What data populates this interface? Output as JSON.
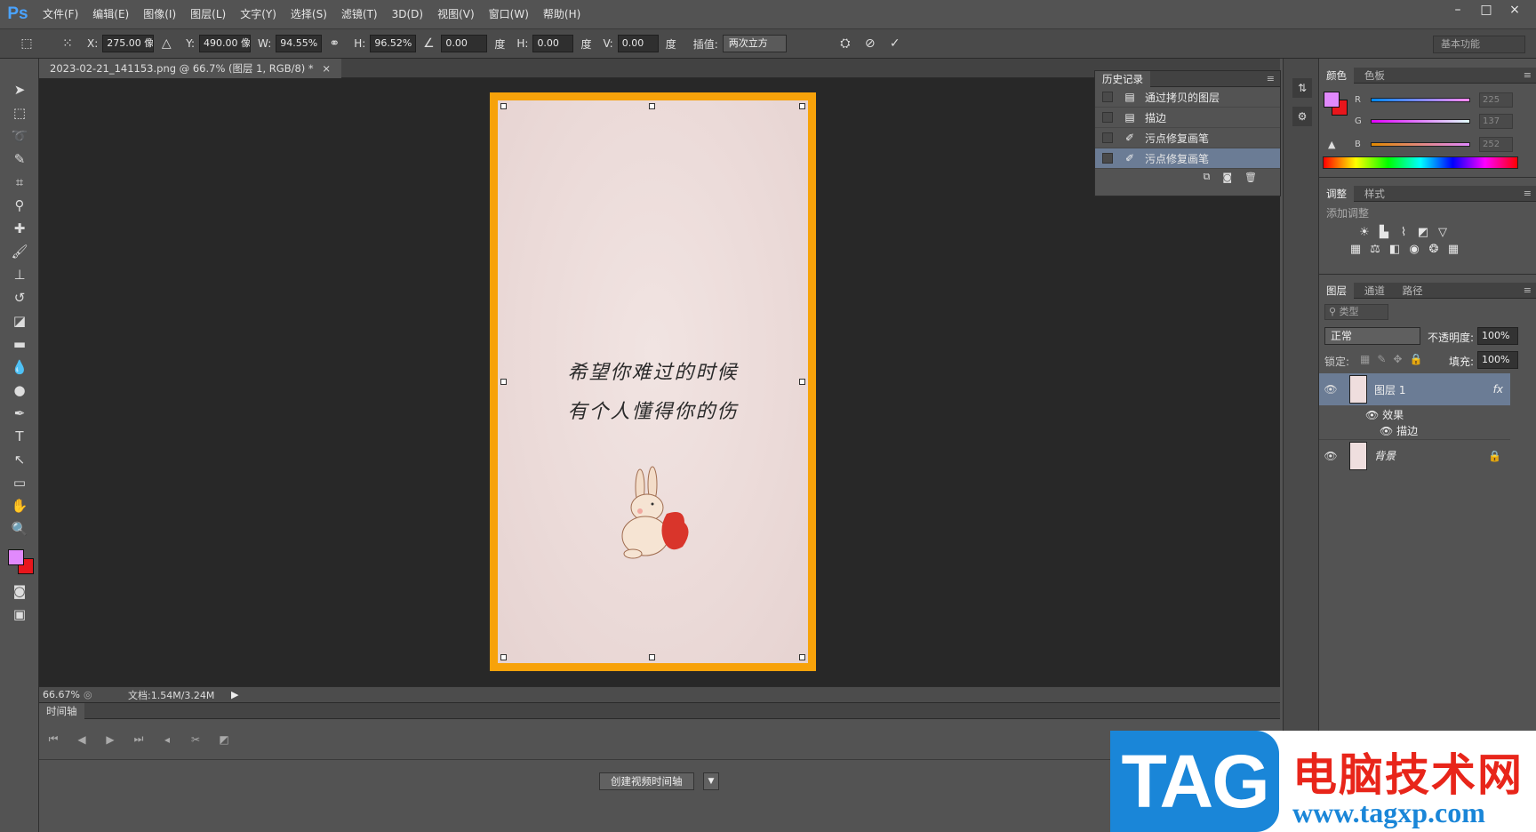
{
  "app": {
    "logo": "Ps"
  },
  "menu": [
    "文件(F)",
    "编辑(E)",
    "图像(I)",
    "图层(L)",
    "文字(Y)",
    "选择(S)",
    "滤镜(T)",
    "3D(D)",
    "视图(V)",
    "窗口(W)",
    "帮助(H)"
  ],
  "window_controls": {
    "minimize": "–",
    "maximize": "□",
    "close": "×"
  },
  "options": {
    "x_label": "X:",
    "x_value": "275.00 像",
    "y_label": "Y:",
    "y_value": "490.00 像",
    "w_label": "W:",
    "w_value": "94.55%",
    "h_label": "H:",
    "h_value": "96.52%",
    "angle_value": "0.00",
    "angle_unit": "度",
    "hskew_label": "H:",
    "hskew_value": "0.00",
    "hskew_unit": "度",
    "vskew_label": "V:",
    "vskew_value": "0.00",
    "vskew_unit": "度",
    "interp_label": "插值:",
    "interp_value": "两次立方",
    "workspace": "基本功能"
  },
  "document": {
    "tab_title": "2023-02-21_141153.png @ 66.7% (图层 1, RGB/8) *",
    "poem_line1": "希望你难过的时候",
    "poem_line2": "有个人懂得你的伤"
  },
  "status": {
    "zoom": "66.67%",
    "doc_size": "文档:1.54M/3.24M"
  },
  "timeline": {
    "tab": "时间轴",
    "create_button": "创建视频时间轴"
  },
  "history": {
    "tab": "历史记录",
    "items": [
      {
        "label": "通过拷贝的图层",
        "icon": "document-icon"
      },
      {
        "label": "描边",
        "icon": "document-icon"
      },
      {
        "label": "污点修复画笔",
        "icon": "healing-brush-icon"
      },
      {
        "label": "污点修复画笔",
        "icon": "healing-brush-icon",
        "selected": true
      }
    ]
  },
  "color_panel": {
    "tabs": [
      "颜色",
      "色板"
    ],
    "r_label": "R",
    "r_value": "225",
    "g_label": "G",
    "g_value": "137",
    "b_label": "B",
    "b_value": "252",
    "foreground": "#e189fc",
    "background": "#e8161c"
  },
  "adjustments": {
    "tabs": [
      "调整",
      "样式"
    ],
    "heading": "添加调整"
  },
  "layers": {
    "tabs": [
      "图层",
      "通道",
      "路径"
    ],
    "filter_label": "类型",
    "blend_mode": "正常",
    "opacity_label": "不透明度:",
    "opacity_value": "100%",
    "lock_label": "锁定:",
    "fill_label": "填充:",
    "fill_value": "100%",
    "items": [
      {
        "name": "图层 1",
        "fx": "fx",
        "effects_label": "效果",
        "effect": "描边"
      },
      {
        "name": "背景"
      }
    ]
  },
  "watermark": {
    "brand": "TAG",
    "title": "电脑技术网",
    "url": "www.tagxp.com"
  }
}
